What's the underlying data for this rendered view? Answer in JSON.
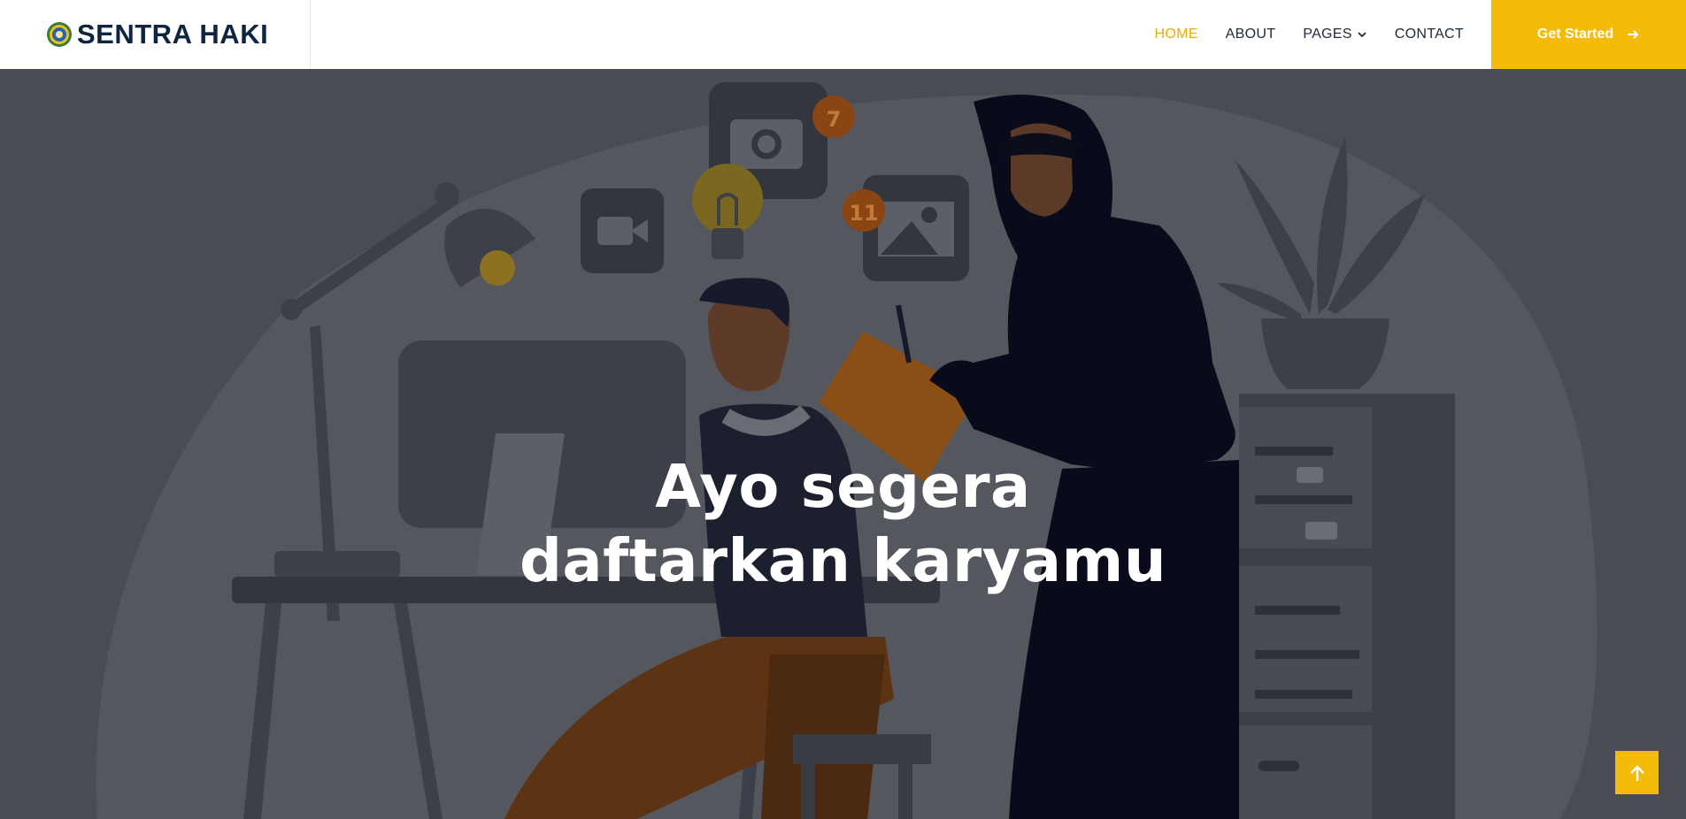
{
  "header": {
    "logo_text": "SENTRA HAKI",
    "nav": [
      {
        "label": "HOME",
        "active": true
      },
      {
        "label": "ABOUT"
      },
      {
        "label": "PAGES"
      },
      {
        "label": "CONTACT"
      }
    ],
    "cta_label": "Get Started"
  },
  "hero": {
    "title_line1": "Ayo segera",
    "title_line2": "daftarkan karyamu",
    "badge_camera": "7",
    "badge_image": "11"
  },
  "colors": {
    "accent": "#f4bc08",
    "nav_active": "#e8ac0c",
    "hero_overlay": "#4a4c53",
    "logo_text": "#0e2440"
  },
  "icons": {
    "logo": "university-emblem-icon",
    "pages_dropdown": "chevron-down-icon",
    "cta": "arrow-right-icon",
    "back_to_top": "arrow-up-icon"
  }
}
